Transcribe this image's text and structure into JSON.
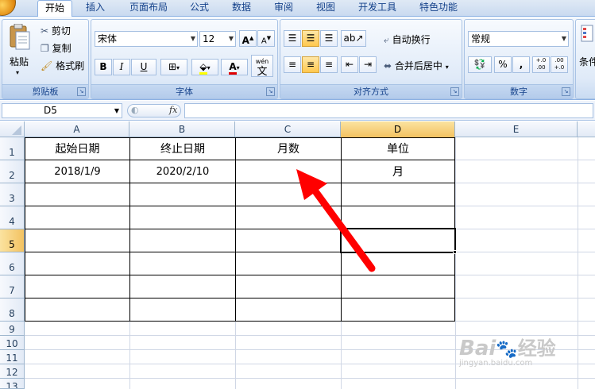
{
  "ribbon_tabs": [
    "开始",
    "插入",
    "页面布局",
    "公式",
    "数据",
    "审阅",
    "视图",
    "开发工具",
    "特色功能"
  ],
  "active_tab": "开始",
  "clipboard": {
    "paste": "粘贴",
    "cut": "剪切",
    "copy": "复制",
    "format_painter": "格式刷",
    "group": "剪贴板"
  },
  "font": {
    "name": "宋体",
    "size": "12",
    "bold": "B",
    "italic": "I",
    "underline": "U",
    "wen": "wén",
    "wen_char": "文",
    "group": "字体"
  },
  "alignment": {
    "wrap": "自动换行",
    "merge": "合并后居中",
    "group": "对齐方式"
  },
  "number": {
    "format": "常规",
    "percent": "%",
    "comma": ",",
    "inc_decimal": "+.0 .00",
    "dec_decimal": ".00 +.0",
    "group": "数字"
  },
  "styles": {
    "conditional": "条件"
  },
  "formula_bar": {
    "name_box": "D5",
    "fx": "fx",
    "content": ""
  },
  "columns": [
    "A",
    "B",
    "C",
    "D",
    "E"
  ],
  "selected_column": "D",
  "rows": [
    "1",
    "2",
    "3",
    "4",
    "5",
    "6",
    "7",
    "8",
    "9",
    "10",
    "11",
    "12",
    "13"
  ],
  "selected_row": "5",
  "cells": {
    "A1": "起始日期",
    "B1": "终止日期",
    "C1": "月数",
    "D1": "单位",
    "A2": "2018/1/9",
    "B2": "2020/2/10",
    "C2": "",
    "D2": "月"
  },
  "watermark": {
    "brand": "Bai",
    "brand_cn": "经验",
    "url": "jingyan.baidu.com"
  },
  "colors": {
    "arrow": "#ff0000",
    "selection_header": "#f3c261",
    "ribbon": "#dbe7f6"
  }
}
